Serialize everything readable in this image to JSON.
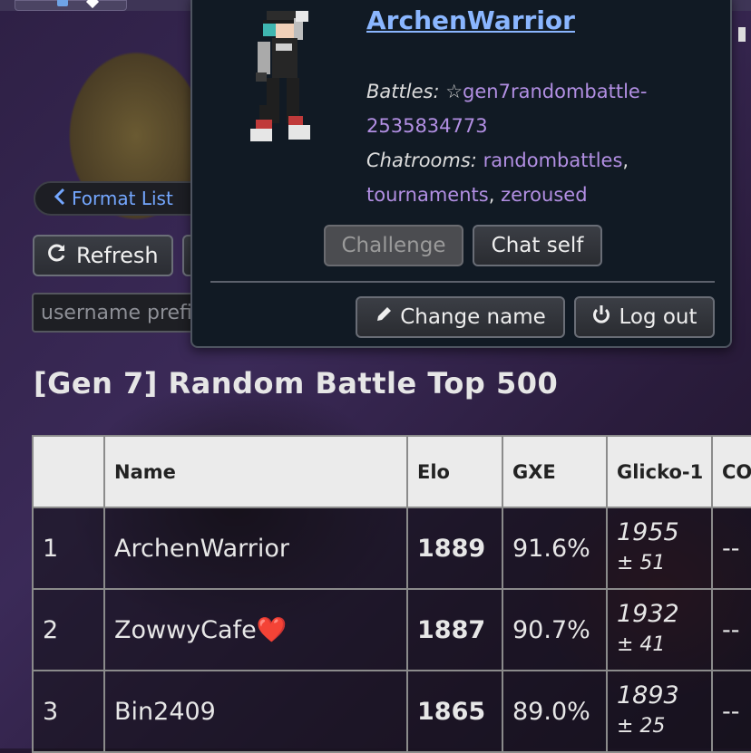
{
  "nav": {
    "format_list_label": "Format List",
    "refresh_label": "Refresh",
    "username_placeholder": "username prefix"
  },
  "page": {
    "title": "[Gen 7] Random Battle Top 500"
  },
  "table": {
    "headers": {
      "rank": "",
      "name": "Name",
      "elo": "Elo",
      "gxe": "GXE",
      "glicko": "Glicko-1",
      "coil": "CO"
    },
    "rows": [
      {
        "rank": "1",
        "name": "ArchenWarrior",
        "heart": "",
        "elo": "1889",
        "gxe": "91.6%",
        "glicko": "1955",
        "glicko_dev": "± 51",
        "coil": "--"
      },
      {
        "rank": "2",
        "name": "ZowwyCafe",
        "heart": "❤️",
        "elo": "1887",
        "gxe": "90.7%",
        "glicko": "1932",
        "glicko_dev": "± 41",
        "coil": "--"
      },
      {
        "rank": "3",
        "name": "Bin2409",
        "heart": "",
        "elo": "1865",
        "gxe": "89.0%",
        "glicko": "1893",
        "glicko_dev": "± 25",
        "coil": "--"
      }
    ]
  },
  "popup": {
    "username": "ArchenWarrior",
    "battles_label": "Battles:",
    "battle_star": "☆",
    "battle_id": "gen7randombattle-2535834773",
    "chatrooms_label": "Chatrooms:",
    "chatrooms": [
      "randombattles",
      "tournaments",
      "zeroused"
    ],
    "challenge_label": "Challenge",
    "chat_self_label": "Chat self",
    "change_name_label": "Change name",
    "log_out_label": "Log out"
  },
  "colors": {
    "link": "#8ab6ff",
    "room_link": "#b28fe3",
    "popup_bg": "#111a24",
    "format_list": "#74a7ff"
  }
}
